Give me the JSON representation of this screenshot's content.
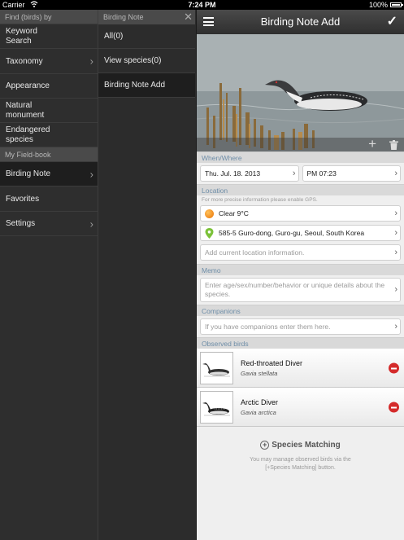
{
  "status_bar": {
    "carrier": "Carrier",
    "time": "7:24 PM",
    "battery": "100%"
  },
  "col1": {
    "find_header": "Find (birds) by",
    "find_items": [
      {
        "label": "Keyword\nSearch",
        "chevron": false
      },
      {
        "label": "Taxonomy",
        "chevron": true
      },
      {
        "label": "Appearance",
        "chevron": false
      },
      {
        "label": "Natural\nmonument",
        "chevron": false
      },
      {
        "label": "Endangered\nspecies",
        "chevron": false
      }
    ],
    "fieldbook_header": "My Field-book",
    "fieldbook_items": [
      {
        "label": "Birding Note",
        "chevron": true,
        "active": true
      },
      {
        "label": "Favorites",
        "chevron": false,
        "active": false
      },
      {
        "label": "Settings",
        "chevron": true,
        "active": false
      }
    ]
  },
  "col2": {
    "header": "Birding Note",
    "close_glyph": "✕",
    "items": [
      {
        "label": "All(0)",
        "active": false
      },
      {
        "label": "View species(0)",
        "active": false
      },
      {
        "label": "Birding Note Add",
        "active": true
      }
    ]
  },
  "detail": {
    "nav": {
      "title": "Birding Note Add",
      "done_glyph": "✓"
    },
    "photo_tools": {
      "add_glyph": "+"
    },
    "when_where": {
      "header": "When/Where",
      "date": "Thu. Jul. 18. 2013",
      "time": "PM 07:23"
    },
    "location": {
      "header": "Location",
      "hint": "For more precise information please enable GPS.",
      "weather": "Clear 9°C",
      "address": "585-5 Guro-dong, Guro-gu, Seoul, South Korea",
      "add_placeholder": "Add current location information."
    },
    "memo": {
      "header": "Memo",
      "placeholder": "Enter age/sex/number/behavior or unique details about the species."
    },
    "companions": {
      "header": "Companions",
      "placeholder": "If you have companions enter them here."
    },
    "observed": {
      "header": "Observed birds",
      "birds": [
        {
          "name": "Red-throated Diver",
          "scientific": "Gavia stellata"
        },
        {
          "name": "Arctic Diver",
          "scientific": "Gavia arctica"
        }
      ]
    },
    "matching": {
      "button_label": "Species Matching",
      "description": "You may manage observed birds via the [+Species Matching] button."
    },
    "colors": {
      "section_header_text": "#6f8ea8",
      "delete": "#d42b2b",
      "weather_icon": "#f08a1e",
      "location_pin": "#7cc23a"
    }
  }
}
